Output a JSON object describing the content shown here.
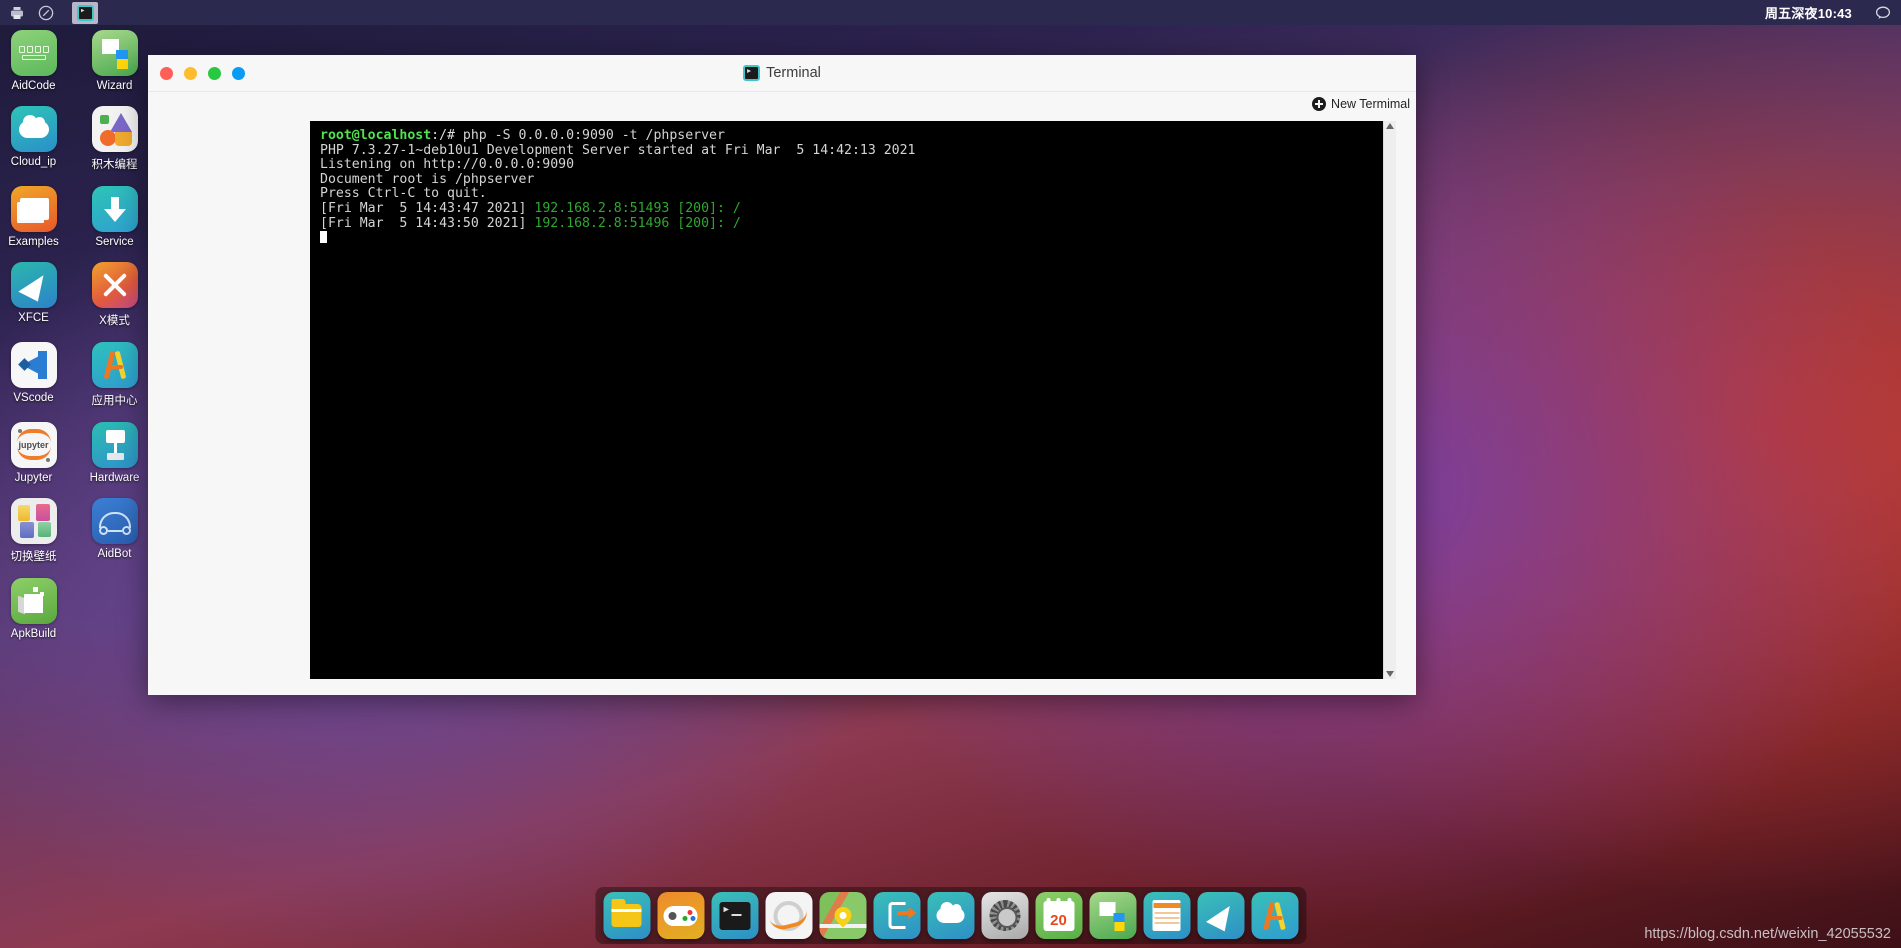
{
  "topbar": {
    "left_icons": [
      {
        "name": "printer-icon",
        "glyph": "⚙"
      },
      {
        "name": "compass-icon",
        "glyph": "◎"
      }
    ],
    "taskbar_item": {
      "name": "terminal-task-button",
      "icon": "terminal-icon"
    },
    "clock": "周五深夜10:43",
    "chat_icon": "💬"
  },
  "desktop_icons": [
    {
      "label": "AidCode",
      "icon": "aidcode-icon",
      "cls": "ic-aidcode"
    },
    {
      "label": "Wizard",
      "icon": "wizard-icon",
      "cls": "ic-wizard"
    },
    {
      "label": "Cloud_ip",
      "icon": "cloud-icon",
      "cls": "ic-cloud"
    },
    {
      "label": "积木编程",
      "icon": "blocks-icon",
      "cls": "ic-jimu"
    },
    {
      "label": "Examples",
      "icon": "examples-icon",
      "cls": "ic-examples"
    },
    {
      "label": "Service",
      "icon": "download-icon",
      "cls": "ic-service"
    },
    {
      "label": "XFCE",
      "icon": "xfce-icon",
      "cls": "ic-xfce"
    },
    {
      "label": "X模式",
      "icon": "xmode-icon",
      "cls": "ic-xmode"
    },
    {
      "label": "VScode",
      "icon": "vscode-icon",
      "cls": "ic-vscode"
    },
    {
      "label": "应用中心",
      "icon": "appcenter-icon",
      "cls": "ic-appcenter"
    },
    {
      "label": "Jupyter",
      "icon": "jupyter-icon",
      "cls": "ic-jupyter"
    },
    {
      "label": "Hardware",
      "icon": "hardware-icon",
      "cls": "ic-hardware"
    },
    {
      "label": "切换壁纸",
      "icon": "wallpaper-icon",
      "cls": "ic-wallpaper"
    },
    {
      "label": "AidBot",
      "icon": "aidbot-icon",
      "cls": "ic-aidbot"
    },
    {
      "label": "ApkBuild",
      "icon": "apkbuild-icon",
      "cls": "ic-apkbuild"
    }
  ],
  "terminal_window": {
    "title": "Terminal",
    "controls": [
      {
        "name": "close-button",
        "color": "#ff5f57"
      },
      {
        "name": "minimize-button",
        "color": "#ffbd2e"
      },
      {
        "name": "maximize-button",
        "color": "#28c840"
      },
      {
        "name": "extra-button",
        "color": "#0a9cf5"
      }
    ],
    "new_terminal_label": "New Termimal",
    "lines": [
      {
        "type": "prompt",
        "user": "root@localhost",
        "path": ":/# ",
        "command": "php -S 0.0.0.0:9090 -t /phpserver"
      },
      {
        "type": "plain",
        "text": "PHP 7.3.27-1~deb10u1 Development Server started at Fri Mar  5 14:42:13 2021"
      },
      {
        "type": "plain",
        "text": "Listening on http://0.0.0.0:9090"
      },
      {
        "type": "plain",
        "text": "Document root is /phpserver"
      },
      {
        "type": "plain",
        "text": "Press Ctrl-C to quit."
      },
      {
        "type": "request",
        "stamp": "[Fri Mar  5 14:43:47 2021] ",
        "detail": "192.168.2.8:51493 [200]: /"
      },
      {
        "type": "request",
        "stamp": "[Fri Mar  5 14:43:50 2021] ",
        "detail": "192.168.2.8:51496 [200]: /"
      }
    ]
  },
  "dock": [
    {
      "name": "dock-files",
      "label": "Files",
      "cls": "dk-files"
    },
    {
      "name": "dock-games",
      "label": "Games",
      "cls": "dk-game"
    },
    {
      "name": "dock-terminal",
      "label": "Terminal",
      "cls": "dk-term"
    },
    {
      "name": "dock-browser",
      "label": "Browser",
      "cls": "dk-browser"
    },
    {
      "name": "dock-maps",
      "label": "Maps",
      "cls": "dk-maps"
    },
    {
      "name": "dock-export",
      "label": "Export",
      "cls": "dk-export"
    },
    {
      "name": "dock-cloud",
      "label": "Cloud",
      "cls": "dk-cloud"
    },
    {
      "name": "dock-settings",
      "label": "Settings",
      "cls": "dk-settings"
    },
    {
      "name": "dock-calendar",
      "label": "Calendar",
      "cls": "dk-cal",
      "day": "20"
    },
    {
      "name": "dock-wizard",
      "label": "Wizard",
      "cls": "dk-wizard"
    },
    {
      "name": "dock-notes",
      "label": "Notes",
      "cls": "dk-notes"
    },
    {
      "name": "dock-xfce",
      "label": "XFCE",
      "cls": "dk-xfce"
    },
    {
      "name": "dock-appcenter",
      "label": "App Center",
      "cls": "dk-appc"
    }
  ],
  "watermark": "https://blog.csdn.net/weixin_42055532",
  "colors": {
    "panel": "#2b2a4e",
    "terminal_bg": "#000000",
    "prompt_green": "#4ee44e",
    "log_green": "#2fa82f",
    "window_chrome": "#f7f7f7"
  }
}
